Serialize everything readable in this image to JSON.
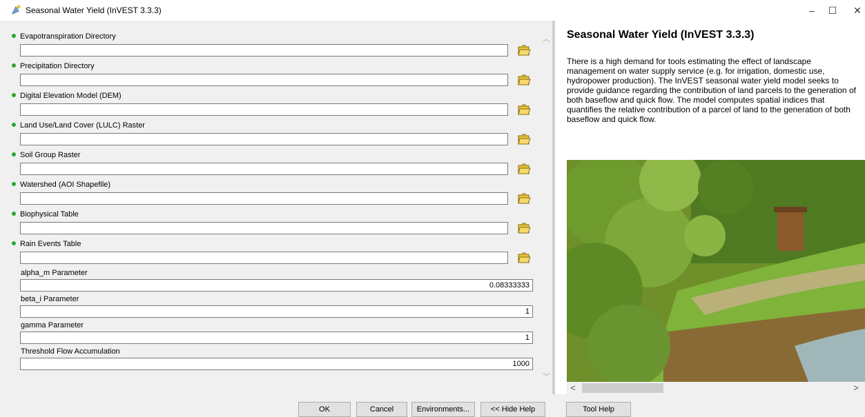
{
  "window": {
    "title": "Seasonal Water Yield (InVEST 3.3.3)",
    "controls": [
      "–",
      "☐",
      "✕"
    ]
  },
  "form": {
    "required_fields": [
      {
        "label": "Evapotranspiration Directory",
        "value": ""
      },
      {
        "label": "Precipitation Directory",
        "value": ""
      },
      {
        "label": "Digital Elevation Model (DEM)",
        "value": ""
      },
      {
        "label": "Land Use/Land Cover (LULC) Raster",
        "value": ""
      },
      {
        "label": "Soil Group Raster",
        "value": ""
      },
      {
        "label": "Watershed (AOI Shapefile)",
        "value": ""
      },
      {
        "label": "Biophysical Table",
        "value": ""
      },
      {
        "label": "Rain Events Table",
        "value": ""
      }
    ],
    "parameters": [
      {
        "label": "alpha_m Parameter",
        "value": "0.08333333"
      },
      {
        "label": "beta_i Parameter",
        "value": "1"
      },
      {
        "label": "gamma Parameter",
        "value": "1"
      },
      {
        "label": "Threshold Flow Accumulation",
        "value": "1000"
      }
    ]
  },
  "help": {
    "title": "Seasonal Water Yield (InVEST 3.3.3)",
    "text": "There is a high demand for tools estimating the effect of landscape management on water supply service (e.g. for irrigation, domestic use, hydropower production). The InVEST seasonal water yield model seeks to provide guidance regarding the contribution of land parcels to the generation of both baseflow and quick flow. The model computes spatial indices that quantifies the relative contribution of a parcel of land to the generation of both baseflow and quick flow."
  },
  "buttons": {
    "ok": "OK",
    "cancel": "Cancel",
    "environments": "Environments...",
    "hide_help": "<< Hide Help",
    "tool_help": "Tool Help"
  },
  "colors": {
    "required_dot": "#2ea52e",
    "folder_icon": "#e8c33c"
  }
}
